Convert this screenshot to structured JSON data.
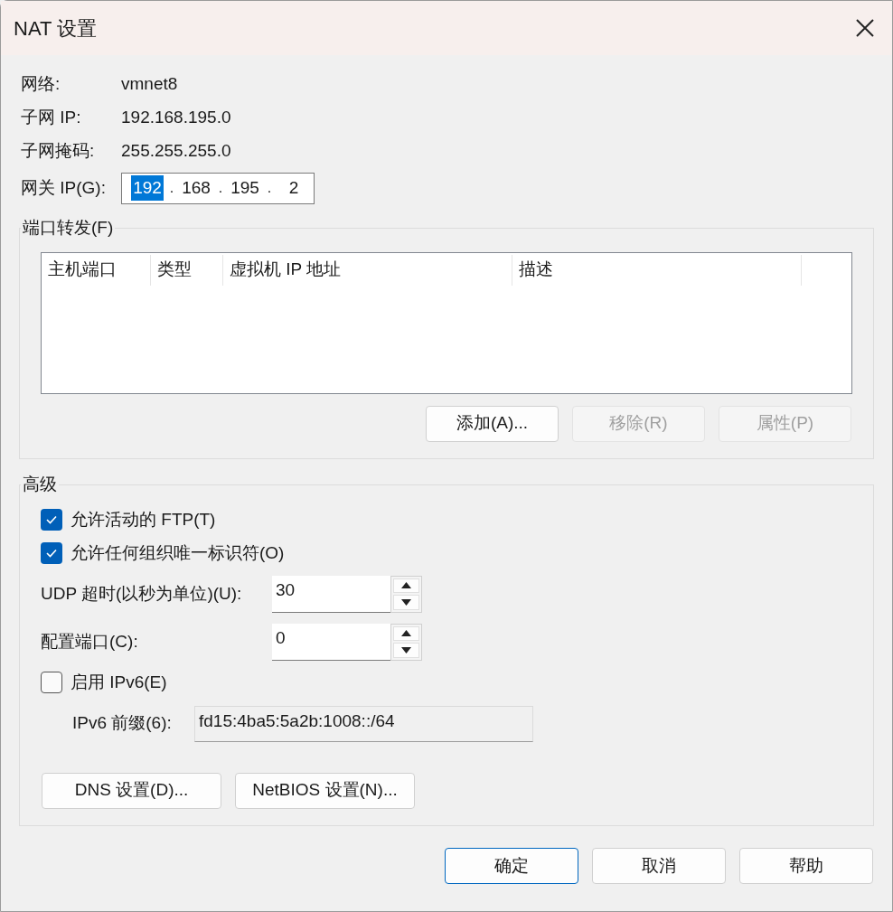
{
  "window": {
    "title": "NAT 设置"
  },
  "info": [
    {
      "label": "网络:",
      "value": "vmnet8"
    },
    {
      "label": "子网 IP:",
      "value": "192.168.195.0"
    },
    {
      "label": "子网掩码:",
      "value": "255.255.255.0"
    }
  ],
  "gateway": {
    "label": "网关 IP(G):",
    "separator": ".",
    "octets": [
      {
        "text": "192",
        "selected": true
      },
      {
        "text": "168",
        "selected": false
      },
      {
        "text": "195",
        "selected": false
      },
      {
        "text": "2",
        "selected": false
      }
    ]
  },
  "port_forwarding": {
    "title": "端口转发(F)",
    "columns": [
      "主机端口",
      "类型",
      "虚拟机 IP 地址",
      "描述"
    ],
    "buttons": [
      {
        "label": "添加(A)...",
        "disabled": false
      },
      {
        "label": "移除(R)",
        "disabled": true
      },
      {
        "label": "属性(P)",
        "disabled": true
      }
    ]
  },
  "advanced": {
    "title": "高级",
    "items": [
      {
        "kind": "checkbox",
        "label": "允许活动的 FTP(T)",
        "checked": true
      },
      {
        "kind": "checkbox",
        "label": "允许任何组织唯一标识符(O)",
        "checked": true
      },
      {
        "kind": "spinner",
        "label": "UDP 超时(以秒为单位)(U):",
        "value": "30"
      },
      {
        "kind": "spinner",
        "label": "配置端口(C):",
        "value": "0"
      },
      {
        "kind": "checkbox",
        "label": "启用 IPv6(E)",
        "checked": false
      },
      {
        "kind": "readonly",
        "label": "IPv6 前缀(6):",
        "value": "fd15:4ba5:5a2b:1008::/64"
      }
    ],
    "buttons": [
      "DNS 设置(D)...",
      "NetBIOS 设置(N)..."
    ]
  },
  "footer_buttons": [
    {
      "label": "确定",
      "default": true
    },
    {
      "label": "取消",
      "default": false
    },
    {
      "label": "帮助",
      "default": false
    }
  ]
}
